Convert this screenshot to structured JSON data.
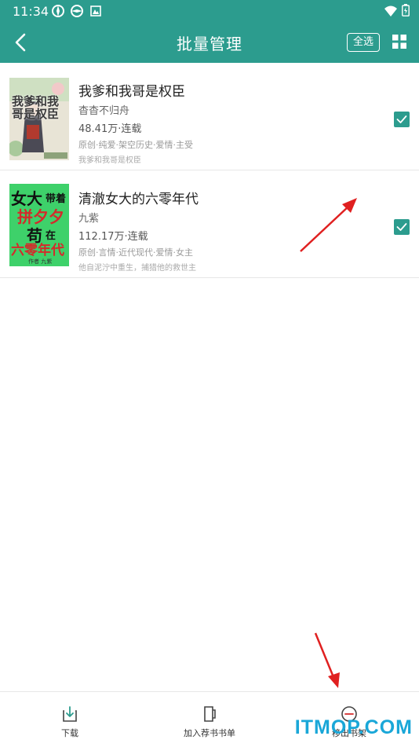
{
  "status_bar": {
    "time": "11:34"
  },
  "header": {
    "title": "批量管理",
    "select_all": "全选"
  },
  "books": [
    {
      "title": "我爹和我哥是权臣",
      "author": "杳杳不归舟",
      "stats": "48.41万·连载",
      "tags": "原创·纯爱·架空历史·爱情·主受",
      "intro": "我爹和我哥是权臣",
      "cover_text": "我爹和我哥是权臣",
      "checked": true
    },
    {
      "title": "清澈女大的六零年代",
      "author": "九紫",
      "stats": "112.17万·连载",
      "tags": "原创·言情·近代现代·爱情·女主",
      "intro": "他自泥泞中重生，捕猎他的救世主",
      "cover_text_1": "女大",
      "cover_text_2": "带着",
      "cover_text_3": "拼夕夕",
      "cover_text_4": "苟",
      "cover_text_5": "在",
      "cover_text_6": "六零年代",
      "cover_author": "作者 九紫",
      "checked": true
    }
  ],
  "bottom_bar": {
    "download": "下载",
    "add_booklist": "加入荐书书单",
    "remove_shelf": "移出书架"
  },
  "watermark": "ITMOP.COM",
  "colors": {
    "primary": "#2c9c8e",
    "arrow": "#e02020"
  }
}
